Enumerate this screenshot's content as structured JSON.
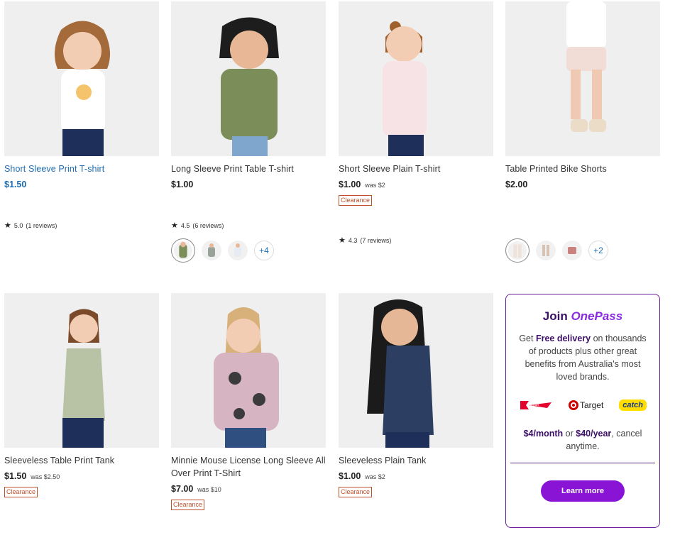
{
  "products": [
    {
      "title": "Short Sleeve Print T-shirt",
      "price": "$1.50",
      "was": "",
      "badge": "",
      "rating": "5.0",
      "reviews": "(1 reviews)",
      "more": ""
    },
    {
      "title": "Long Sleeve Print Table T-shirt",
      "price": "$1.00",
      "was": "",
      "badge": "",
      "rating": "4.5",
      "reviews": "(6 reviews)",
      "more": "+4"
    },
    {
      "title": "Short Sleeve Plain T-shirt",
      "price": "$1.00",
      "was": "was $2",
      "badge": "Clearance",
      "rating": "4.3",
      "reviews": "(7 reviews)",
      "more": ""
    },
    {
      "title": "Table Printed Bike Shorts",
      "price": "$2.00",
      "was": "",
      "badge": "",
      "rating": "",
      "reviews": "",
      "more": "+2"
    },
    {
      "title": "Sleeveless Table Print Tank",
      "price": "$1.50",
      "was": "was $2.50",
      "badge": "Clearance",
      "rating": "",
      "reviews": "",
      "more": ""
    },
    {
      "title_line1": "Minnie Mouse License Long Sleeve All",
      "title_line2": "Over Print T-Shirt",
      "price": "$7.00",
      "was": "was $10",
      "badge": "Clearance",
      "rating": "",
      "reviews": "",
      "more": ""
    },
    {
      "title": "Sleeveless Plain Tank",
      "price": "$1.00",
      "was": "was $2",
      "badge": "Clearance",
      "rating": "",
      "reviews": "",
      "more": ""
    }
  ],
  "onepass": {
    "join": "Join",
    "brand": "OnePass",
    "body_pre": "Get",
    "body_bold": "Free delivery",
    "body_post": "on thousands of products plus other great benefits from Australia's most loved brands.",
    "logo_kmart": "kmart",
    "logo_target": "Target",
    "logo_catch": "catch",
    "price_month": "$4/month",
    "price_or": "or",
    "price_year": "$40/year",
    "price_tail": ", cancel anytime.",
    "cta": "Learn more"
  },
  "colors": {
    "link_blue": "#1f6db2",
    "clearance": "#c0502b",
    "onepass_purple": "#8a14d6",
    "onepass_dark": "#3b0f66",
    "kmart_red": "#e4032e",
    "target_red": "#cc0000",
    "catch_yellow": "#ffdd00"
  }
}
